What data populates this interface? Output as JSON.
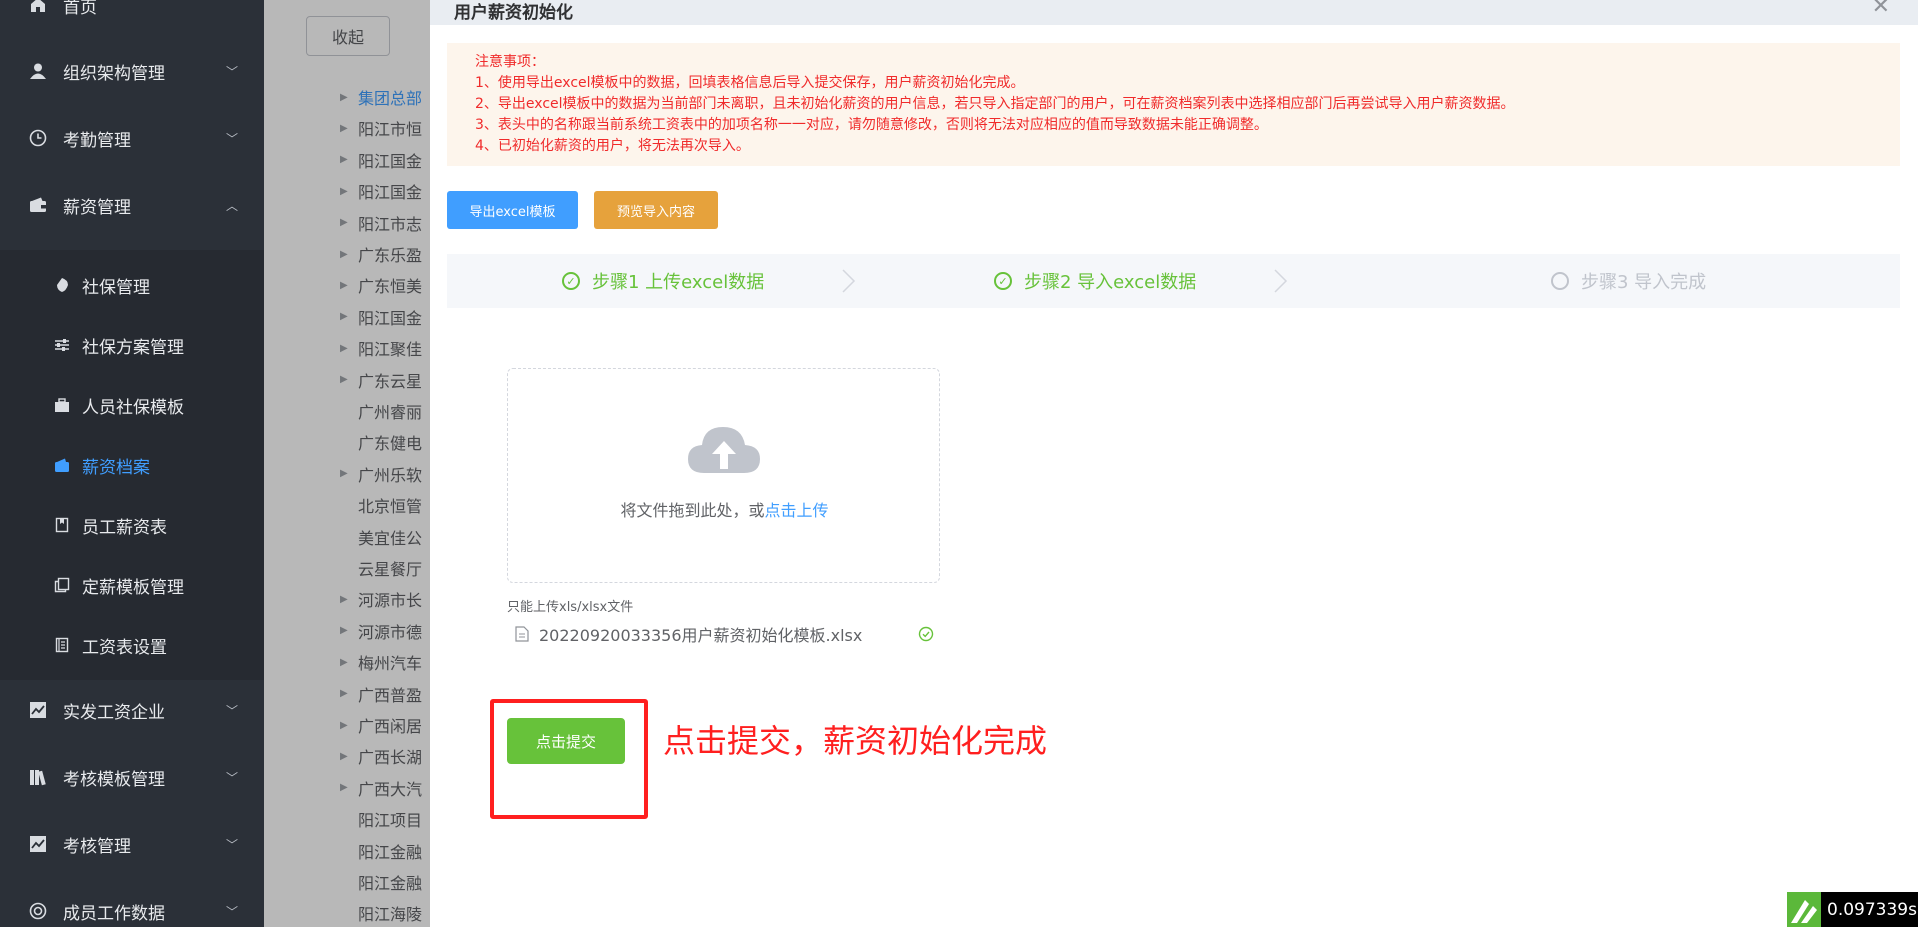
{
  "sidebar": {
    "items": [
      {
        "label": "首页",
        "icon": "home-icon"
      },
      {
        "label": "组织架构管理",
        "icon": "user-icon"
      },
      {
        "label": "考勤管理",
        "icon": "clock-icon"
      },
      {
        "label": "薪资管理",
        "icon": "wallet-icon"
      },
      {
        "label": "实发工资企业",
        "icon": "chart-icon"
      },
      {
        "label": "考核模板管理",
        "icon": "books-icon"
      },
      {
        "label": "考核管理",
        "icon": "chart-icon"
      },
      {
        "label": "成员工作数据",
        "icon": "lifebuoy-icon"
      }
    ],
    "subitems": [
      {
        "label": "社保管理",
        "icon": "shield-icon"
      },
      {
        "label": "社保方案管理",
        "icon": "sliders-icon"
      },
      {
        "label": "人员社保模板",
        "icon": "briefcase-icon"
      },
      {
        "label": "薪资档案",
        "icon": "wallet-icon"
      },
      {
        "label": "员工薪资表",
        "icon": "book-icon"
      },
      {
        "label": "定薪模板管理",
        "icon": "copy-icon"
      },
      {
        "label": "工资表设置",
        "icon": "list-icon"
      }
    ]
  },
  "background": {
    "collapse_label": "收起",
    "tree": [
      {
        "label": "集团总部",
        "expandable": true,
        "selected": true
      },
      {
        "label": "阳江市恒",
        "expandable": true
      },
      {
        "label": "阳江国金",
        "expandable": true
      },
      {
        "label": "阳江国金",
        "expandable": true
      },
      {
        "label": "阳江市志",
        "expandable": true
      },
      {
        "label": "广东乐盈",
        "expandable": true
      },
      {
        "label": "广东恒美",
        "expandable": true
      },
      {
        "label": "阳江国金",
        "expandable": true
      },
      {
        "label": "阳江聚佳",
        "expandable": true
      },
      {
        "label": "广东云星",
        "expandable": true
      },
      {
        "label": "广州睿丽",
        "expandable": false
      },
      {
        "label": "广东健电",
        "expandable": false
      },
      {
        "label": "广州乐软",
        "expandable": true
      },
      {
        "label": "北京恒管",
        "expandable": false
      },
      {
        "label": "美宜佳公",
        "expandable": false
      },
      {
        "label": "云星餐厅",
        "expandable": false
      },
      {
        "label": "河源市长",
        "expandable": true
      },
      {
        "label": "河源市德",
        "expandable": true
      },
      {
        "label": "梅州汽车",
        "expandable": true
      },
      {
        "label": "广西普盈",
        "expandable": true
      },
      {
        "label": "广西闲居",
        "expandable": true
      },
      {
        "label": "广西长湖",
        "expandable": true
      },
      {
        "label": "广西大汽",
        "expandable": true
      },
      {
        "label": "阳江项目",
        "expandable": false
      },
      {
        "label": "阳江金融",
        "expandable": false
      },
      {
        "label": "阳江金融",
        "expandable": false
      },
      {
        "label": "阳江海陵",
        "expandable": false
      }
    ]
  },
  "dialog": {
    "title": "用户薪资初始化",
    "close_icon": "close-icon",
    "notice": {
      "heading": "注意事项：",
      "lines": [
        "1、使用导出excel模板中的数据，回填表格信息后导入提交保存，用户薪资初始化完成。",
        "2、导出excel模板中的数据为当前部门未离职，且未初始化薪资的用户信息，若只导入指定部门的用户，可在薪资档案列表中选择相应部门后再尝试导入用户薪资数据。",
        "3、表头中的名称跟当前系统工资表中的加项名称一一对应，请勿随意修改，否则将无法对应相应的值而导致数据未能正确调整。",
        "4、已初始化薪资的用户，将无法再次导入。"
      ]
    },
    "buttons": {
      "export": "导出excel模板",
      "preview": "预览导入内容"
    },
    "steps": [
      {
        "label": "步骤1 上传excel数据",
        "status": "done"
      },
      {
        "label": "步骤2 导入excel数据",
        "status": "done"
      },
      {
        "label": "步骤3 导入完成",
        "status": "todo"
      }
    ],
    "upload": {
      "text_prefix": "将文件拖到此处，或",
      "text_link": "点击上传",
      "tip": "只能上传xls/xlsx文件",
      "file_name": "20220920033356用户薪资初始化模板.xlsx"
    },
    "submit_label": "点击提交",
    "annotation": "点击提交，薪资初始化完成"
  },
  "timer": {
    "value": "0.097339s"
  },
  "colors": {
    "primary": "#409eff",
    "success": "#67c23a",
    "warning": "#e6a23c",
    "danger": "#ff1f1f",
    "sidebar": "#2b3038"
  }
}
